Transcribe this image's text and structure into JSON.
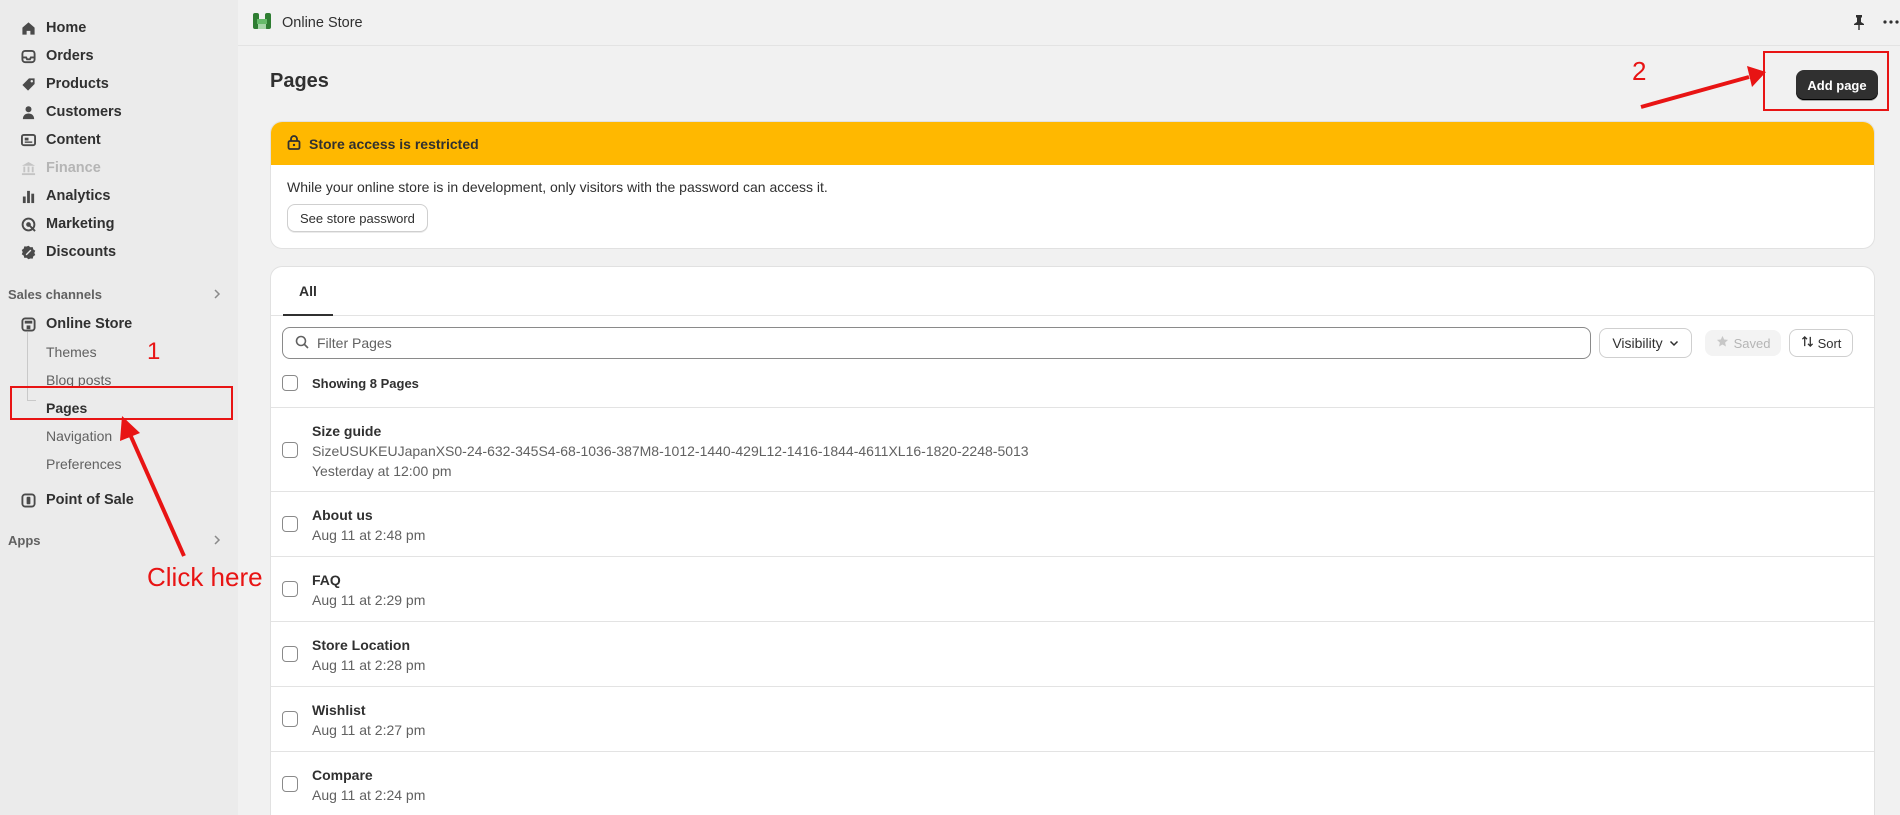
{
  "sidebar": {
    "main_items": [
      {
        "label": "Home",
        "icon": "home-icon",
        "disabled": false
      },
      {
        "label": "Orders",
        "icon": "inbox-icon",
        "disabled": false
      },
      {
        "label": "Products",
        "icon": "tag-icon",
        "disabled": false
      },
      {
        "label": "Customers",
        "icon": "person-icon",
        "disabled": false
      },
      {
        "label": "Content",
        "icon": "image-icon",
        "disabled": false
      },
      {
        "label": "Finance",
        "icon": "bank-icon",
        "disabled": true
      },
      {
        "label": "Analytics",
        "icon": "bar-chart-icon",
        "disabled": false
      },
      {
        "label": "Marketing",
        "icon": "target-icon",
        "disabled": false
      },
      {
        "label": "Discounts",
        "icon": "discount-icon",
        "disabled": false
      }
    ],
    "sales_channels_label": "Sales channels",
    "online_store_label": "Online Store",
    "sub_items": [
      "Themes",
      "Blog posts",
      "Pages",
      "Navigation",
      "Preferences"
    ],
    "active_sub_item": "Pages",
    "point_of_sale_label": "Point of Sale",
    "apps_label": "Apps"
  },
  "topbar": {
    "title": "Online Store"
  },
  "page": {
    "title": "Pages",
    "add_button": "Add page"
  },
  "banner": {
    "title": "Store access is restricted",
    "text": "While your online store is in development, only visitors with the password can access it.",
    "button": "See store password",
    "color": "#ffb800"
  },
  "list": {
    "tab": "All",
    "search_placeholder": "Filter Pages",
    "visibility_label": "Visibility",
    "saved_label": "Saved",
    "sort_label": "Sort",
    "showing": "Showing 8 Pages",
    "rows": [
      {
        "name": "Size guide",
        "content": "SizeUSUKEUJapanXS0-24-632-345S4-68-1036-387M8-1012-1440-429L12-1416-1844-4611XL16-1820-2248-5013",
        "date": "Yesterday at 12:00 pm"
      },
      {
        "name": "About us",
        "date": "Aug 11 at 2:48 pm"
      },
      {
        "name": "FAQ",
        "date": "Aug 11 at 2:29 pm"
      },
      {
        "name": "Store Location",
        "date": "Aug 11 at 2:28 pm"
      },
      {
        "name": "Wishlist",
        "date": "Aug 11 at 2:27 pm"
      },
      {
        "name": "Compare",
        "date": "Aug 11 at 2:24 pm"
      }
    ]
  },
  "annotations": {
    "step1": "1",
    "step2": "2",
    "click_here": "Click here",
    "color": "#e81414"
  }
}
